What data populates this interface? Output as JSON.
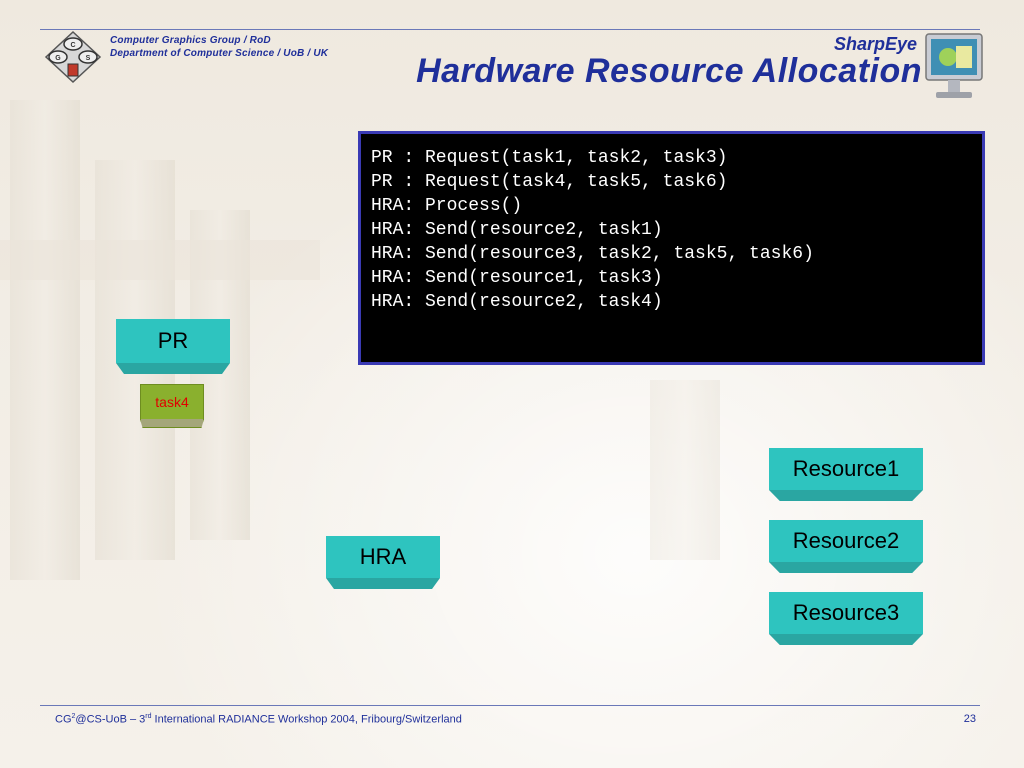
{
  "header": {
    "org_line1": "Computer Graphics Group / RoD",
    "org_line2": "Department of Computer Science / UoB / UK",
    "brand": "SharpEye",
    "title": "Hardware Resource Allocation"
  },
  "console": {
    "lines": [
      "PR : Request(task1, task2, task3)",
      "PR : Request(task4, task5, task6)",
      "HRA: Process()",
      "HRA: Send(resource2, task1)",
      "HRA: Send(resource3, task2, task5, task6)",
      "HRA: Send(resource1, task3)",
      "HRA: Send(resource2, task4)"
    ]
  },
  "diagram": {
    "pr_label": "PR",
    "task_label": "task4",
    "hra_label": "HRA",
    "resources": [
      "Resource1",
      "Resource2",
      "Resource3"
    ]
  },
  "footer": {
    "prefix": "CG",
    "prefix_sup": "2",
    "mid": "@CS-UoB – 3",
    "mid_sup": "rd",
    "rest": " International RADIANCE Workshop 2004, Fribourg/Switzerland",
    "page_number": "23"
  },
  "colors": {
    "accent": "#1f2f9a",
    "box_fill": "#2ec4bf",
    "task_fill": "#8ab02e",
    "task_text": "#e00000",
    "console_border": "#3a3ab4"
  }
}
